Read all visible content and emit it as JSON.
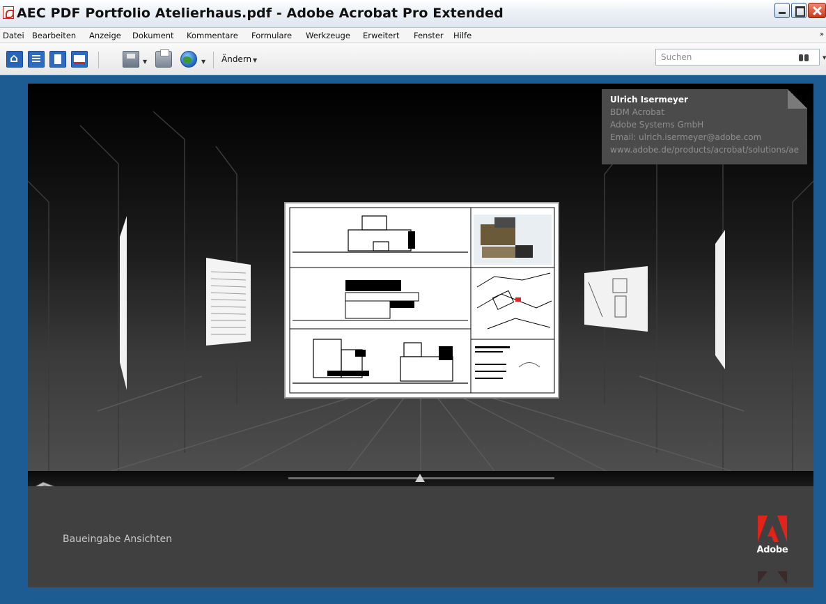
{
  "window": {
    "title": "AEC PDF Portfolio Atelierhaus.pdf - Adobe Acrobat Pro Extended"
  },
  "menubar": {
    "items": [
      "Datei",
      "Bearbeiten",
      "Anzeige",
      "Dokument",
      "Kommentare",
      "Formulare",
      "Werkzeuge",
      "Erweitert",
      "Fenster",
      "Hilfe"
    ],
    "more": "»"
  },
  "toolbar": {
    "aendern_label": "Ändern",
    "search_placeholder": "Suchen",
    "icons": [
      "home-icon",
      "list-view-icon",
      "page-icon",
      "layout-icon",
      "save-icon",
      "print-icon",
      "globe-icon"
    ]
  },
  "contact_card": {
    "name": "Ulrich Isermeyer",
    "role": "BDM Acrobat",
    "company": "Adobe Systems GmbH",
    "email": "Email: ulrich.isermeyer@adobe.com",
    "url": "www.adobe.de/products/acrobat/solutions/ae"
  },
  "portfolio": {
    "current_caption": "Baueingabe Ansichten",
    "brand": "Adobe"
  },
  "colors": {
    "desktop_blue": "#1d5c93",
    "adobe_red": "#e2231a",
    "panel_gray": "#404040"
  }
}
